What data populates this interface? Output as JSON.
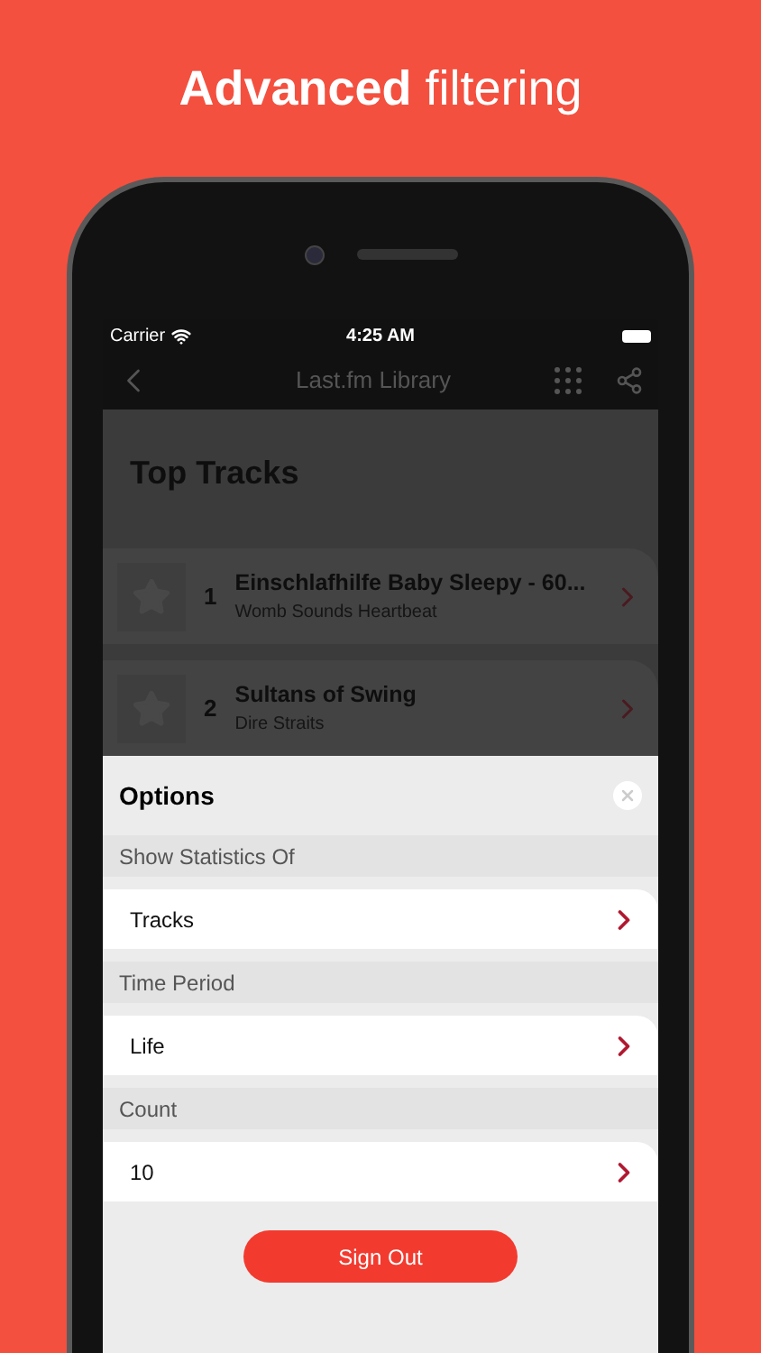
{
  "headline": "**Advanced** filtering",
  "status_bar": {
    "carrier": "Carrier",
    "time": "4:25 AM"
  },
  "nav_bar": {
    "title": "Last.fm Library"
  },
  "page": {
    "title": "Top Tracks",
    "tracks": [
      {
        "rank": "1",
        "title": "Einschlafhilfe Baby Sleepy - 60...",
        "artist": "Womb Sounds Heartbeat"
      },
      {
        "rank": "2",
        "title": "Sultans of Swing",
        "artist": "Dire Straits"
      }
    ]
  },
  "options": {
    "title": "Options",
    "sections": [
      {
        "header": "Show Statistics Of",
        "value": "Tracks"
      },
      {
        "header": "Time Period",
        "value": "Life"
      },
      {
        "header": "Count",
        "value": "10"
      }
    ],
    "button": "Sign Out"
  }
}
